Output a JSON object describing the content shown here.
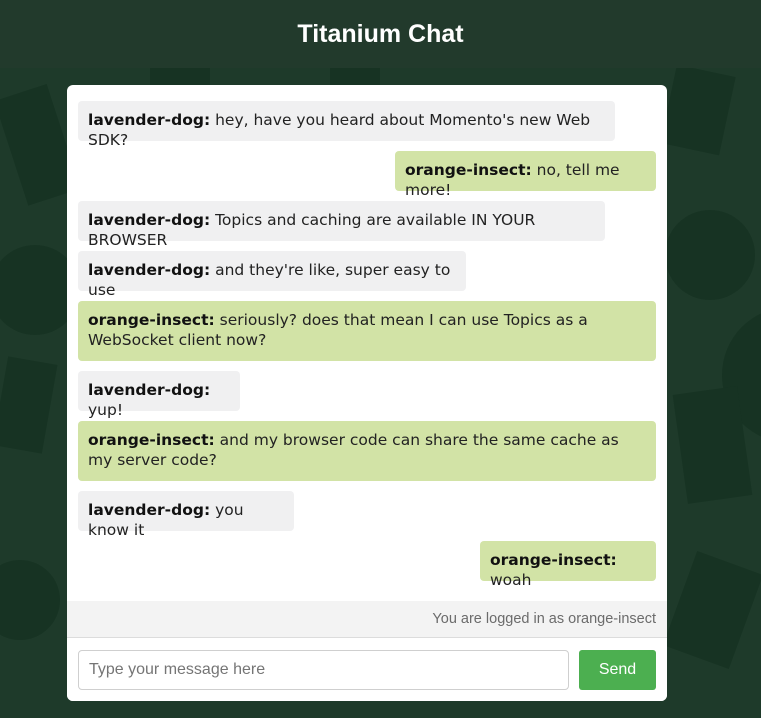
{
  "header": {
    "title": "Titanium Chat"
  },
  "messages": [
    {
      "user": "lavender-dog:",
      "text": " hey, have you heard about Momento's new Web SDK?",
      "kind": "other"
    },
    {
      "user": "orange-insect:",
      "text": " no, tell me more!",
      "kind": "self"
    },
    {
      "user": "lavender-dog:",
      "text": " Topics and caching are available IN YOUR BROWSER",
      "kind": "other"
    },
    {
      "user": "lavender-dog:",
      "text": " and they're like, super easy to use",
      "kind": "other"
    },
    {
      "user": "orange-insect:",
      "text": " seriously? does that mean I can use Topics as a WebSocket client now?",
      "kind": "self"
    },
    {
      "user": "lavender-dog:",
      "text": " yup!",
      "kind": "other"
    },
    {
      "user": "orange-insect:",
      "text": " and my browser code can share the same cache as my server code?",
      "kind": "self"
    },
    {
      "user": "lavender-dog:",
      "text": " you know it",
      "kind": "other"
    },
    {
      "user": "orange-insect:",
      "text": " woah",
      "kind": "self"
    }
  ],
  "status": {
    "text": "You are logged in as orange-insect"
  },
  "composer": {
    "placeholder": "Type your message here",
    "value": "",
    "send_label": "Send"
  },
  "colors": {
    "background": "#1e3a2a",
    "header": "#223a2c",
    "self_bubble": "#d2e3a6",
    "other_bubble": "#f0f0f1",
    "send_button": "#4caf50"
  }
}
